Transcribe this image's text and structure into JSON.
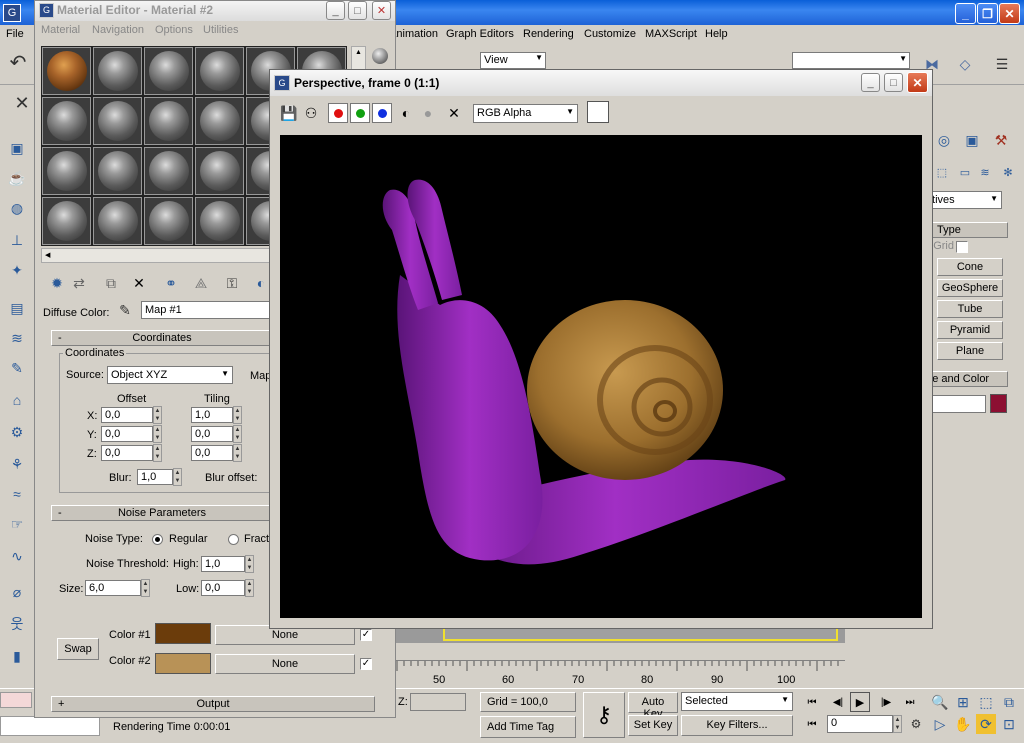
{
  "main": {
    "menu": [
      "File",
      "Animation",
      "Graph Editors",
      "Rendering",
      "Customize",
      "MAXScript",
      "Help"
    ],
    "view_select": "View",
    "create_panel": {
      "category": "Primitives",
      "rollout_type": "Type",
      "autogrid": "AutoGrid",
      "buttons": [
        "Cone",
        "GeoSphere",
        "Tube",
        "Pyramid",
        "Plane"
      ],
      "rollout_color": "Name and Color"
    },
    "timeline": {
      "ticks": [
        "50",
        "60",
        "70",
        "80",
        "90",
        "100"
      ]
    },
    "status": {
      "z_label": "Z:",
      "grid": "Grid = 100,0",
      "add_time_tag": "Add Time Tag",
      "auto_key": "Auto Key",
      "set_key": "Set Key",
      "selected": "Selected",
      "key_filters": "Key Filters...",
      "frame": "0",
      "rendering_time": "Rendering Time  0:00:01"
    },
    "colors": {
      "object_swatch": "#8c0f32",
      "timeline_highlight": "#f0e030"
    }
  },
  "material_editor": {
    "title": "Material Editor - Material #2",
    "menu": [
      "Material",
      "Navigation",
      "Options",
      "Utilities"
    ],
    "diffuse_label": "Diffuse Color:",
    "map_name": "Map #1",
    "coordinates": {
      "rollout": "Coordinates",
      "group": "Coordinates",
      "source_label": "Source:",
      "source_value": "Object XYZ",
      "map_label": "Map",
      "offset_label": "Offset",
      "tiling_label": "Tiling",
      "axes": [
        "X:",
        "Y:",
        "Z:"
      ],
      "offset": [
        "0,0",
        "0,0",
        "0,0"
      ],
      "tiling": [
        "1,0",
        "0,0",
        "0,0"
      ],
      "blur_label": "Blur:",
      "blur": "1,0",
      "blur_offset_label": "Blur offset:"
    },
    "noise": {
      "rollout": "Noise Parameters",
      "type_label": "Noise Type:",
      "regular": "Regular",
      "fractal": "Fractal",
      "threshold_label": "Noise Threshold:",
      "high_label": "High:",
      "high": "1,0",
      "size_label": "Size:",
      "size": "6,0",
      "low_label": "Low:",
      "low": "0,0",
      "swap": "Swap",
      "color1_label": "Color #1",
      "color2_label": "Color #2",
      "color1": "#6b3c0b",
      "color2": "#b89257",
      "none": "None"
    },
    "output_rollout": "Output"
  },
  "render_window": {
    "title": "Perspective, frame 0 (1:1)",
    "channel": "RGB Alpha",
    "colors": {
      "red": "#e01010",
      "green": "#10a010",
      "blue": "#1030e0",
      "snail_body": "#a12fc4",
      "shell": "#9c6f2e"
    }
  }
}
